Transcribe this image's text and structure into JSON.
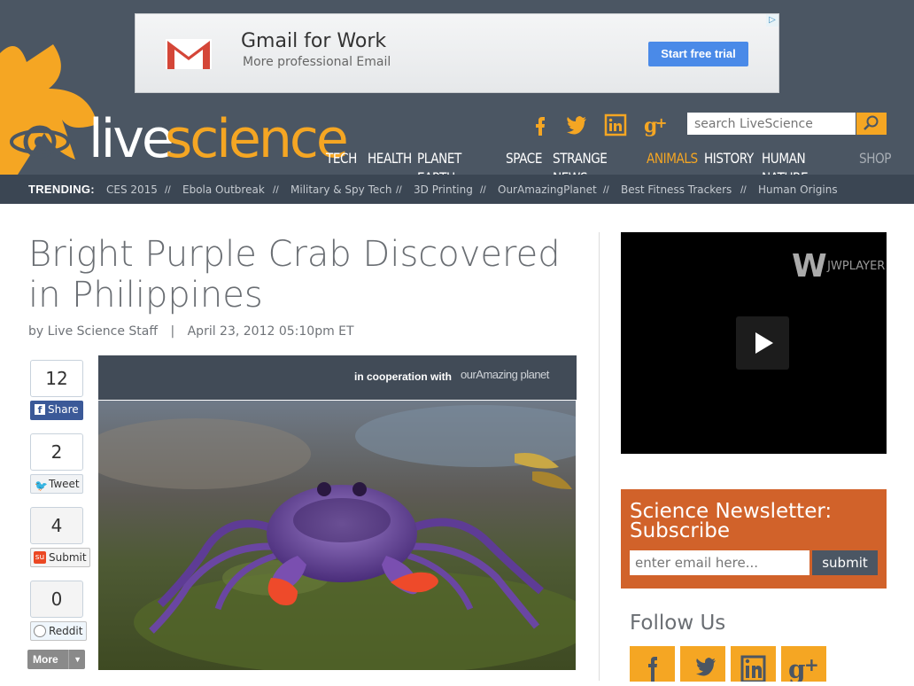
{
  "ad": {
    "title": "Gmail for Work",
    "subtitle": "More professional Email",
    "cta": "Start free trial",
    "adchoices_icon": "adchoices-icon",
    "logo_icon": "gmail-logo-icon"
  },
  "brand": {
    "live": "live",
    "science": "science",
    "accent_color": "#f5a623",
    "header_bg": "#4b5663"
  },
  "search": {
    "placeholder": "search LiveScience",
    "button_icon": "search-icon"
  },
  "social_icons": [
    "facebook-icon",
    "twitter-icon",
    "linkedin-icon",
    "google-plus-icon"
  ],
  "nav": {
    "items": [
      {
        "label": "TECH",
        "active": false
      },
      {
        "label": "HEALTH",
        "active": false
      },
      {
        "label": "PLANET EARTH",
        "active": false
      },
      {
        "label": "SPACE",
        "active": false
      },
      {
        "label": "STRANGE NEWS",
        "active": false
      },
      {
        "label": "ANIMALS",
        "active": true
      },
      {
        "label": "HISTORY",
        "active": false
      },
      {
        "label": "HUMAN NATURE",
        "active": false
      },
      {
        "label": "SHOP",
        "active": false
      }
    ]
  },
  "trending": {
    "label": "TRENDING:",
    "separator": "//",
    "items": [
      "CES 2015",
      "Ebola Outbreak",
      "Military & Spy Tech",
      "3D Printing",
      "OurAmazingPlanet",
      "Best Fitness Trackers",
      "Human Origins"
    ]
  },
  "article": {
    "title": "Bright Purple Crab Discovered in Philippines",
    "author": "by Live Science Staff",
    "divider": "|",
    "date": "April 23, 2012 05:10pm ET",
    "coop_text": "in cooperation with",
    "coop_logo": "ourAmazing planet"
  },
  "share": {
    "facebook": {
      "count": "12",
      "label": "Share"
    },
    "twitter": {
      "count": "2",
      "label": "Tweet"
    },
    "stumbleupon": {
      "count": "4",
      "label": "Submit"
    },
    "reddit": {
      "count": "0",
      "label": "Reddit"
    },
    "more_label": "More"
  },
  "video": {
    "brand": "JWPLAYER",
    "play_icon": "play-icon"
  },
  "newsletter": {
    "title": "Science Newsletter: Subscribe",
    "placeholder": "enter email here...",
    "submit": "submit"
  },
  "follow": {
    "title": "Follow Us",
    "icons": [
      "facebook-icon",
      "twitter-icon",
      "linkedin-icon",
      "google-plus-icon"
    ]
  }
}
